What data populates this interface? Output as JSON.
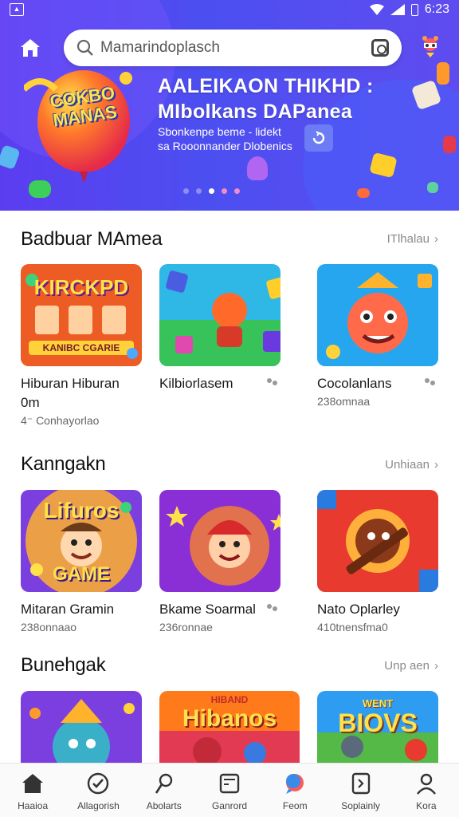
{
  "status_bar": {
    "time": "6:23"
  },
  "search": {
    "value": "Mamarindoplasch"
  },
  "banner": {
    "title_line1": "AALEIKAON THIKHD :",
    "title_line2": "MIbolkans DAPanea",
    "sub_line1": "Sbonkenpe beme - lidekt",
    "sub_line2": "sa Rooonnander Dlobenics",
    "balloon_text": "COKBO MANAS"
  },
  "sections": [
    {
      "title": "Badbuar MAmea",
      "see_all": "ITlhalau",
      "items": [
        {
          "name": "Hiburan Hiburan 0m",
          "meta": "4⁻ Conhayorlao",
          "thumb_text": "KIRCKPD",
          "thumb_text2": "KANIBC CGARIE",
          "colors": [
            "#ff7a1a",
            "#c9243a"
          ]
        },
        {
          "name": "Kilbiorlasem",
          "meta": "",
          "thumb_text": "",
          "thumb_text2": "",
          "colors": [
            "#2fb7e6",
            "#37c25a"
          ]
        },
        {
          "name": "Cocolanlans",
          "meta": "238omnaa",
          "thumb_text": "",
          "thumb_text2": "",
          "colors": [
            "#26a6ef",
            "#ffb22b"
          ]
        }
      ]
    },
    {
      "title": "Kanngakn",
      "see_all": "Unhiaan",
      "items": [
        {
          "name": "Mitaran Gramin",
          "meta": "238onnaao",
          "thumb_text": "Lifuros",
          "thumb_text2": "GAME",
          "colors": [
            "#ffb12b",
            "#7b3fe0"
          ]
        },
        {
          "name": "Bkame Soarmal",
          "meta": "236ronnae",
          "thumb_text": "",
          "thumb_text2": "",
          "colors": [
            "#8a2fd6",
            "#ff8a1f"
          ]
        },
        {
          "name": "Nato Oplarley",
          "meta": "410tnensfma0",
          "thumb_text": "",
          "thumb_text2": "",
          "colors": [
            "#e83a2e",
            "#2a7be0"
          ]
        }
      ]
    },
    {
      "title": "Bunehgak",
      "see_all": "Unp aen",
      "items": [
        {
          "name": "",
          "meta": "",
          "thumb_text": "",
          "thumb_text2": "",
          "colors": [
            "#7b3fe0",
            "#ff9b2a"
          ]
        },
        {
          "name": "",
          "meta": "",
          "thumb_text": "Hibanos",
          "thumb_text2": "HIBAND",
          "colors": [
            "#ff7a1a",
            "#e23a52"
          ]
        },
        {
          "name": "",
          "meta": "",
          "thumb_text": "BIOVS",
          "thumb_text2": "WENT",
          "colors": [
            "#2e9cf0",
            "#54b947"
          ]
        }
      ]
    }
  ],
  "bottom_nav": [
    {
      "label": "Haaioa",
      "icon": "home-icon"
    },
    {
      "label": "Allagorish",
      "icon": "check-circle-icon"
    },
    {
      "label": "Abolarts",
      "icon": "pin-icon"
    },
    {
      "label": "Ganrord",
      "icon": "card-icon"
    },
    {
      "label": "Feom",
      "icon": "chat-icon"
    },
    {
      "label": "Soplainly",
      "icon": "document-icon"
    },
    {
      "label": "Kora",
      "icon": "profile-icon"
    }
  ],
  "colors": {
    "header": "#5141f0",
    "accent": "#4f46e5"
  }
}
